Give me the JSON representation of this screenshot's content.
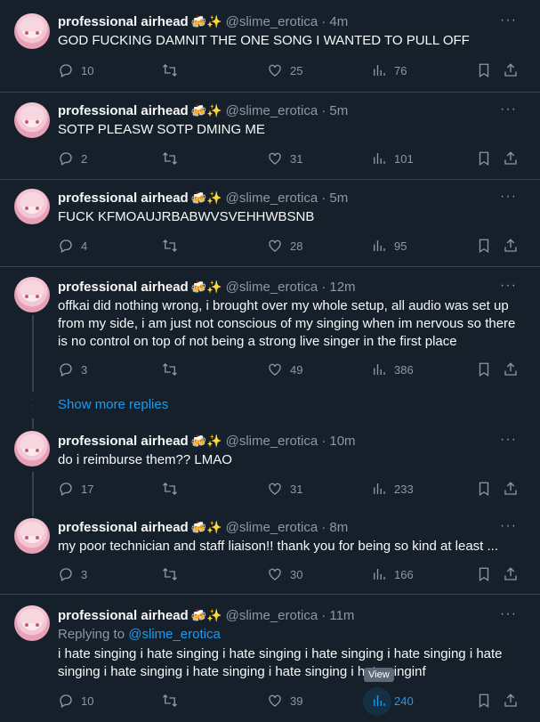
{
  "tweets": [
    {
      "name": "professional airhead",
      "emoji": "🍻✨",
      "handle": "@slime_erotica",
      "time": "· 4m",
      "text": "GOD FUCKING DAMNIT THE ONE SONG I WANTED TO PULL OFF",
      "replies": "10",
      "retweets": "",
      "likes": "25",
      "views": "76"
    },
    {
      "name": "professional airhead",
      "emoji": "🍻✨",
      "handle": "@slime_erotica",
      "time": "· 5m",
      "text": "SOTP PLEASW SOTP DMING ME",
      "replies": "2",
      "retweets": "",
      "likes": "31",
      "views": "101"
    },
    {
      "name": "professional airhead",
      "emoji": "🍻✨",
      "handle": "@slime_erotica",
      "time": "· 5m",
      "text": "FUCK KFMOAUJRBABWVSVEHHWBSNB",
      "replies": "4",
      "retweets": "",
      "likes": "28",
      "views": "95"
    },
    {
      "name": "professional airhead",
      "emoji": "🍻✨",
      "handle": "@slime_erotica",
      "time": "· 12m",
      "text": "offkai did nothing wrong, i brought over my whole setup, all audio was set up from my side, i am just not conscious of my singing when im nervous so there is no control on top of not being a strong live singer in the first place",
      "replies": "3",
      "retweets": "",
      "likes": "49",
      "views": "386"
    },
    {
      "name": "professional airhead",
      "emoji": "🍻✨",
      "handle": "@slime_erotica",
      "time": "· 10m",
      "text": "do i reimburse them?? LMAO",
      "replies": "17",
      "retweets": "",
      "likes": "31",
      "views": "233"
    },
    {
      "name": "professional airhead",
      "emoji": "🍻✨",
      "handle": "@slime_erotica",
      "time": "· 8m",
      "text": "my poor technician and staff liaison!! thank you for being so kind at least ...",
      "replies": "3",
      "retweets": "",
      "likes": "30",
      "views": "166"
    },
    {
      "name": "professional airhead",
      "emoji": "🍻✨",
      "handle": "@slime_erotica",
      "time": "· 11m",
      "reply_prefix": "Replying to",
      "reply_handle": "@slime_erotica",
      "text": "i hate singing i hate singing i hate singing i hate singing i hate singing i hate singing i hate singing i hate singing i hate singing i hate singinf",
      "replies": "10",
      "retweets": "",
      "likes": "39",
      "views": "240"
    }
  ],
  "more_glyph": "···",
  "show_more_replies": "Show more replies",
  "tooltip": "View",
  "colors": {
    "background": "#15202b",
    "accent": "#1d9bf0",
    "muted": "#8b98a5",
    "border": "#38444d"
  }
}
